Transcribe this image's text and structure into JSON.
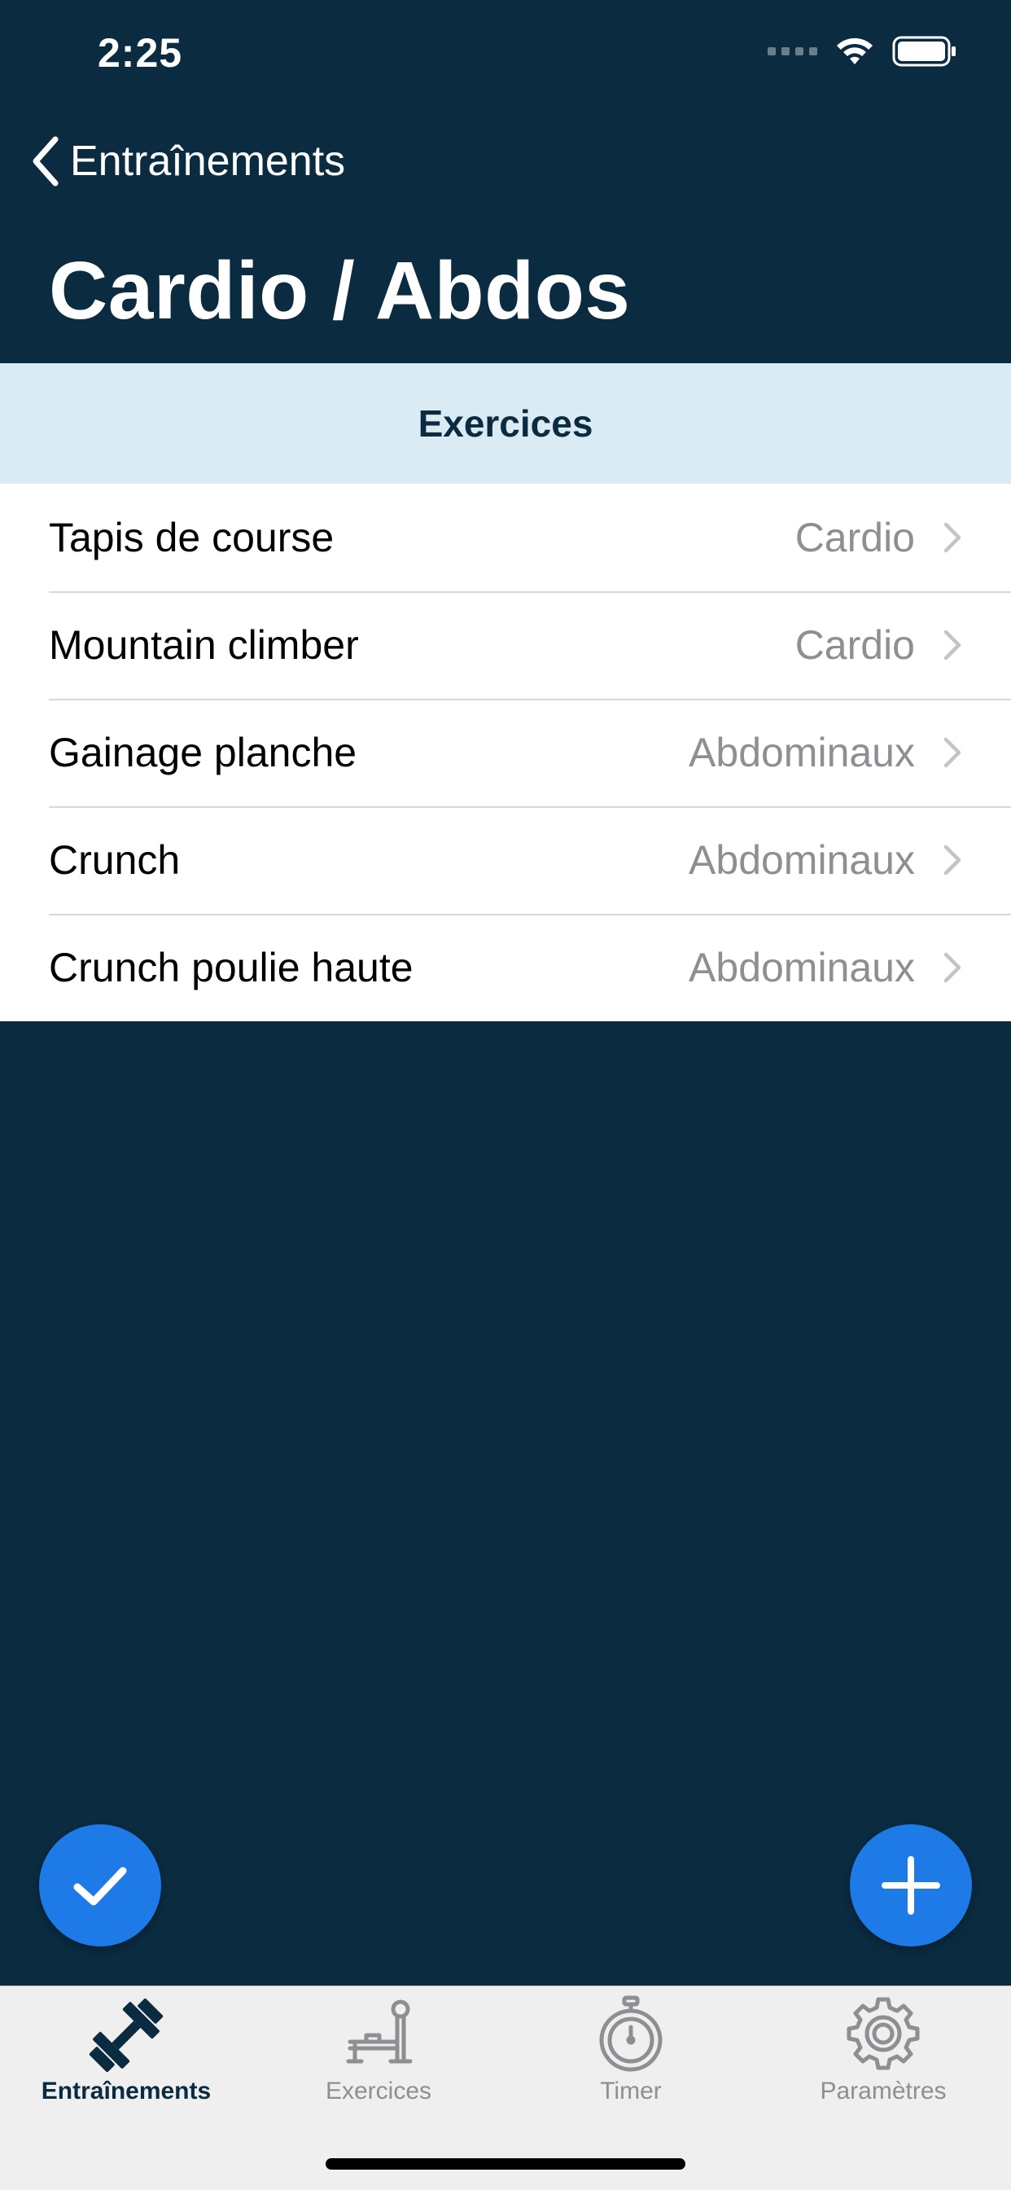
{
  "status_bar": {
    "time": "2:25"
  },
  "nav": {
    "back_label": "Entraînements",
    "title": "Cardio / Abdos"
  },
  "section": {
    "title": "Exercices"
  },
  "exercises": [
    {
      "name": "Tapis de course",
      "category": "Cardio"
    },
    {
      "name": "Mountain climber",
      "category": "Cardio"
    },
    {
      "name": "Gainage planche",
      "category": "Abdominaux"
    },
    {
      "name": "Crunch",
      "category": "Abdominaux"
    },
    {
      "name": "Crunch poulie haute",
      "category": "Abdominaux"
    }
  ],
  "fabs": {
    "left_icon": "checkmark-icon",
    "right_icon": "plus-icon"
  },
  "tabs": [
    {
      "label": "Entraînements",
      "icon": "dumbbell-icon",
      "active": true
    },
    {
      "label": "Exercices",
      "icon": "machine-icon",
      "active": false
    },
    {
      "label": "Timer",
      "icon": "stopwatch-icon",
      "active": false
    },
    {
      "label": "Paramètres",
      "icon": "gear-icon",
      "active": false
    }
  ],
  "colors": {
    "background": "#0a2b40",
    "section_header": "#dbebf4",
    "accent": "#1e7ae6",
    "secondary_text": "#8e8e93"
  }
}
